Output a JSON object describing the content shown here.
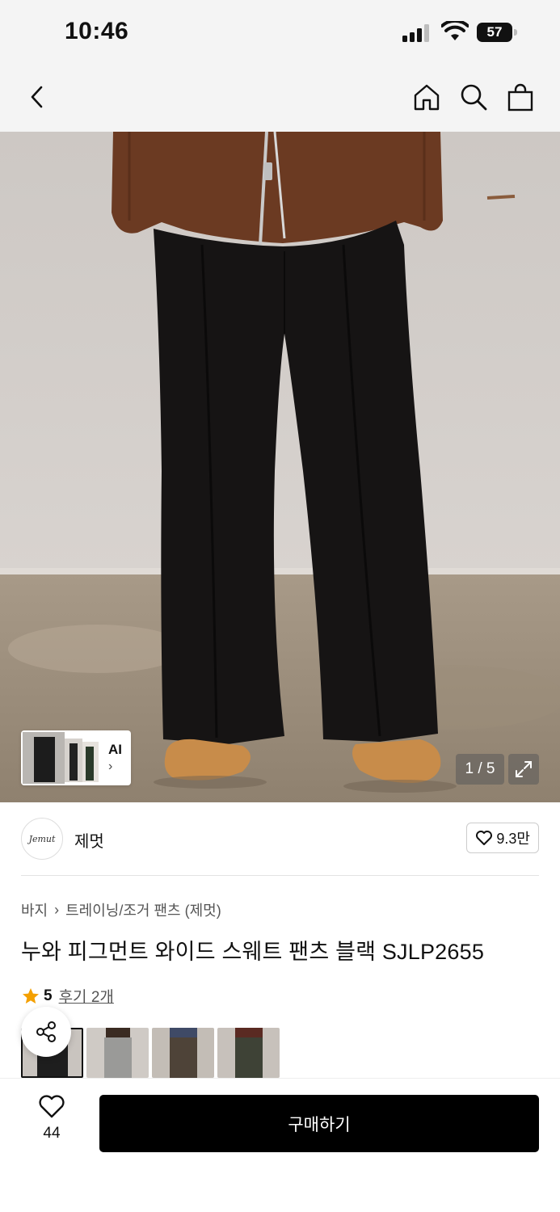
{
  "status_bar": {
    "time": "10:46",
    "battery": "57"
  },
  "nav": {
    "back_icon": "chevron-left-icon",
    "home_icon": "home-icon",
    "search_icon": "search-icon",
    "cart_icon": "shopping-bag-icon"
  },
  "gallery": {
    "ai_label": "AI",
    "ai_chevron": "›",
    "counter": "1 / 5",
    "current": 1,
    "total": 5
  },
  "brand": {
    "logo_text": "Jemut",
    "name": "제멋",
    "likes": "9.3만"
  },
  "breadcrumb": {
    "category": "바지",
    "separator": "›",
    "subcategory": "트레이닝/조거 팬츠 (제멋)"
  },
  "product": {
    "title": "누와 피그먼트 와이드 스웨트 팬츠 블랙 SJLP2655"
  },
  "rating": {
    "score": "5",
    "reviews": "후기 2개"
  },
  "swatches": [
    {
      "color": "#1e1e1e",
      "label": "black"
    },
    {
      "color": "#9a9a98",
      "label": "grey"
    },
    {
      "color": "#4e4338",
      "label": "brown"
    },
    {
      "color": "#3e4236",
      "label": "khaki"
    }
  ],
  "bottom": {
    "wish_count": "44",
    "buy_label": "구매하기"
  },
  "colors": {
    "accent": "#000000",
    "star": "#f4a000",
    "background": "#f4f4f4"
  }
}
